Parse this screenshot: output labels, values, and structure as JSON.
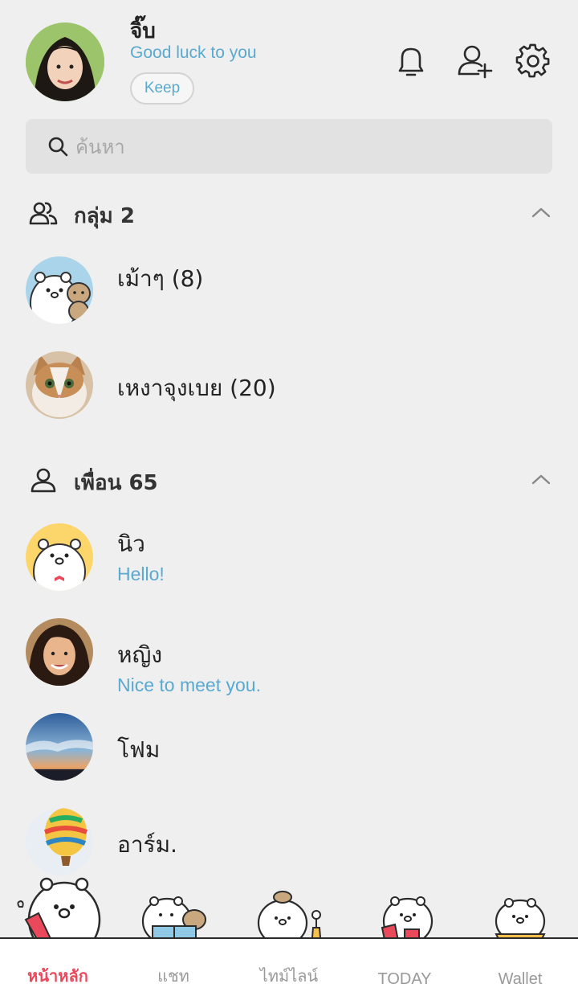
{
  "profile": {
    "name": "จิ๊บ",
    "status": "Good luck to you",
    "keep_label": "Keep"
  },
  "header_icons": [
    "bell-icon",
    "add-friend-icon",
    "gear-icon"
  ],
  "search": {
    "placeholder": "ค้นหา",
    "value": ""
  },
  "groups": {
    "title": "กลุ่ม 2",
    "items": [
      {
        "name": "เม้าๆ (8)"
      },
      {
        "name": "เหงาจุงเบย (20)"
      }
    ]
  },
  "friends": {
    "title": "เพื่อน 65",
    "items": [
      {
        "name": "นิว",
        "status": "Hello!"
      },
      {
        "name": "หญิง",
        "status": "Nice to meet you."
      },
      {
        "name": "โฟม",
        "status": ""
      },
      {
        "name": "อาร์ม.",
        "status": ""
      }
    ]
  },
  "tabs": [
    {
      "label": "หน้าหลัก",
      "active": true
    },
    {
      "label": "แชท",
      "active": false
    },
    {
      "label": "ไทม์ไลน์",
      "active": false
    },
    {
      "label": "TODAY",
      "active": false
    },
    {
      "label": "Wallet",
      "active": false
    }
  ],
  "colors": {
    "accent": "#5aa9cf",
    "active_tab": "#e9495b",
    "background": "#efefef"
  }
}
